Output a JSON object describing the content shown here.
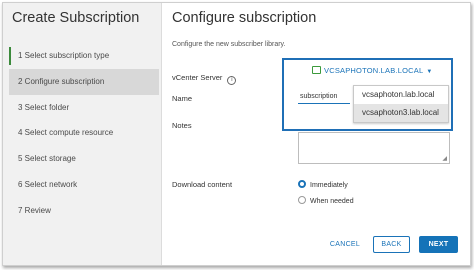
{
  "wizard": {
    "title": "Create Subscription",
    "steps": [
      {
        "label": "1  Select subscription type",
        "state": "done"
      },
      {
        "label": "2  Configure subscription",
        "state": "active"
      },
      {
        "label": "3  Select folder",
        "state": "pending"
      },
      {
        "label": "4  Select compute resource",
        "state": "pending"
      },
      {
        "label": "5  Select storage",
        "state": "pending"
      },
      {
        "label": "6  Select network",
        "state": "pending"
      },
      {
        "label": "7  Review",
        "state": "pending"
      }
    ]
  },
  "page": {
    "title": "Configure subscription",
    "description": "Configure the new subscriber library."
  },
  "form": {
    "vcenter_label": "vCenter Server",
    "vcenter_info_icon": "info-icon",
    "vcenter_selected": "VCSAPHOTON.LAB.LOCAL",
    "vcenter_options": [
      "vcsaphoton.lab.local",
      "vcsaphoton3.lab.local"
    ],
    "vcenter_option_highlighted": "vcsaphoton3.lab.local",
    "name_label": "Name",
    "name_value": "subscription",
    "notes_label": "Notes",
    "notes_value": "",
    "download_label": "Download content",
    "download_options": [
      {
        "label": "Immediately",
        "selected": true
      },
      {
        "label": "When needed",
        "selected": false
      }
    ]
  },
  "buttons": {
    "cancel": "CANCEL",
    "back": "BACK",
    "next": "NEXT"
  },
  "colors": {
    "accent": "#1a73b8",
    "highlight_border": "#1f6fb6",
    "step_done": "#3c8a3c"
  }
}
